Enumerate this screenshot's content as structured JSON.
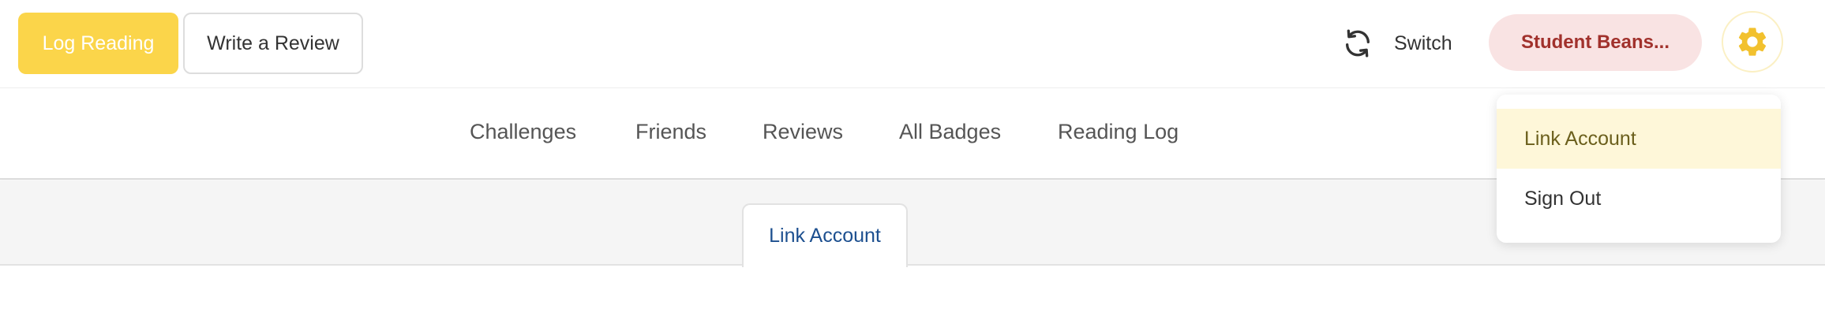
{
  "colors": {
    "accent_yellow": "#fbd54a",
    "user_pill_bg": "#f9e3e3",
    "user_pill_text": "#a1312c",
    "tab_text": "#1c4f8f",
    "dropdown_active_bg": "#fef7d9"
  },
  "header": {
    "log_reading_label": "Log Reading",
    "write_review_label": "Write a Review",
    "switch_label": "Switch",
    "switch_icon": "refresh-icon",
    "user_name": "Student Beans...",
    "settings_icon": "gear-icon"
  },
  "nav": {
    "items": [
      {
        "label": "Challenges"
      },
      {
        "label": "Friends"
      },
      {
        "label": "Reviews"
      },
      {
        "label": "All Badges"
      },
      {
        "label": "Reading Log"
      }
    ]
  },
  "tabs": {
    "active_label": "Link Account"
  },
  "dropdown": {
    "items": [
      {
        "label": "Link Account",
        "active": true
      },
      {
        "label": "Sign Out",
        "active": false
      }
    ]
  }
}
